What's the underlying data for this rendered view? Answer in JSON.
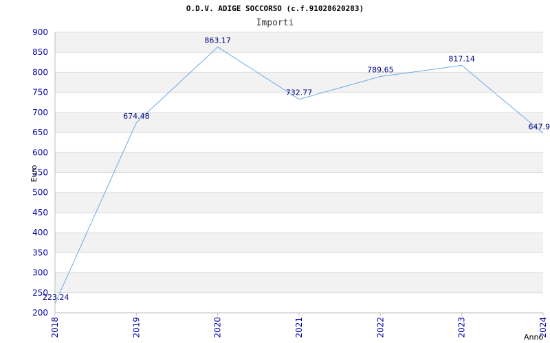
{
  "chart_data": {
    "type": "line",
    "title": "O.D.V. ADIGE SOCCORSO (c.f.91028620283)",
    "subtitle": "Importi",
    "xlabel": "Anno",
    "ylabel": "Euro",
    "categories": [
      "2018",
      "2019",
      "2020",
      "2021",
      "2022",
      "2023",
      "2024"
    ],
    "values": [
      223.24,
      674.48,
      863.17,
      732.77,
      789.65,
      817.14,
      647.9
    ],
    "data_labels": [
      "223.24",
      "674.48",
      "863.17",
      "732.77",
      "789.65",
      "817.14",
      "647.9"
    ],
    "ylim": [
      200,
      900
    ],
    "yticks": [
      200,
      250,
      300,
      350,
      400,
      450,
      500,
      550,
      600,
      650,
      700,
      750,
      800,
      850,
      900
    ],
    "grid": true,
    "line_color": "#6aa9e8",
    "band_color": "#f2f2f2",
    "tick_color": "#0000aa"
  }
}
